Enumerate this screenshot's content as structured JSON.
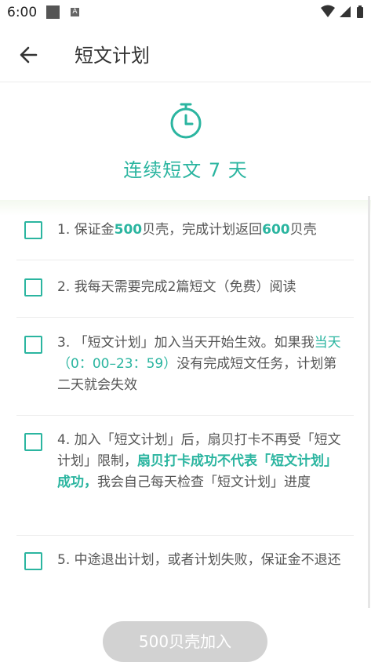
{
  "status_bar": {
    "time": "6:00",
    "a_badge": "A"
  },
  "header": {
    "title": "短文计划"
  },
  "hero": {
    "title": "连续短文 7 天"
  },
  "rules": [
    {
      "parts": [
        "1. 保证金",
        "500",
        "贝壳，完成计划返回",
        "600",
        "贝壳"
      ]
    },
    {
      "parts": [
        "2. 我每天需要完成2篇短文（免费）阅读"
      ]
    },
    {
      "parts": [
        "3. 「短文计划」加入当天开始生效。如果我",
        "当天（0：00–23：59）",
        "没有完成短文任务，计划第二天就会失效"
      ]
    },
    {
      "parts": [
        "4. 加入「短文计划」后，扇贝打卡不再受「短文计划」限制，",
        "扇贝打卡成功不代表「短文计划」成功，",
        "我会自己每天检查「短文计划」进度"
      ]
    },
    {
      "parts": [
        "5. 中途退出计划，或者计划失败，保证金不退还"
      ]
    }
  ],
  "footer": {
    "join_button": "500贝壳加入"
  },
  "colors": {
    "accent": "#2bb5a0",
    "button_disabled": "#d2d2d2"
  }
}
